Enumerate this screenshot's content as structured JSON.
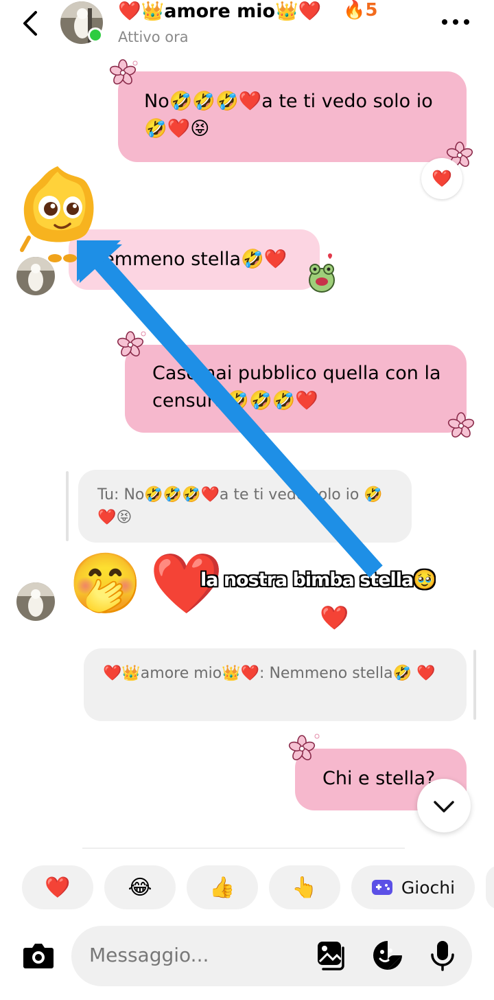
{
  "header": {
    "contact_name": "❤️👑amore mio👑❤️",
    "streak": "🔥5",
    "status": "Attivo ora"
  },
  "messages": {
    "m1_text": "No🤣🤣🤣❤️a te ti vedo solo io🤣❤️😝",
    "m1_reaction": "❤️",
    "m2_text": "Nemmeno stella🤣❤️",
    "m3_text": "Casomai pubblico quella con la censura🤣🤣🤣❤️",
    "reply1_text": "Tu: No🤣🤣🤣❤️a te ti vedo solo io 🤣❤️😝",
    "big_emoji_1": "🤭",
    "big_emoji_2": "❤️",
    "caption": "la nostra bimba stella🥹",
    "caption_reaction": "❤️",
    "reply2_text": "❤️👑amore mio👑❤️: Nemmeno stella🤣 ❤️",
    "m4_text": "Chi e stella?"
  },
  "quick_reactions": [
    {
      "emoji": "❤️"
    },
    {
      "emoji": "😂"
    },
    {
      "emoji": "👍"
    },
    {
      "emoji": "👆"
    },
    {
      "emoji": "🎮",
      "label": "Giochi"
    }
  ],
  "composer": {
    "placeholder": "Messaggio..."
  },
  "colors": {
    "outgoing_bubble": "#f6b8cd",
    "incoming_bubble": "#fcd5e2",
    "accent_arrow": "#1e8fe6",
    "streak": "#f26b1d"
  },
  "icons": [
    "back-arrow-icon",
    "more-options-icon",
    "flower-sticker-icon",
    "camera-icon",
    "gallery-icon",
    "sticker-icon",
    "microphone-icon",
    "chevron-down-icon",
    "game-controller-icon"
  ]
}
